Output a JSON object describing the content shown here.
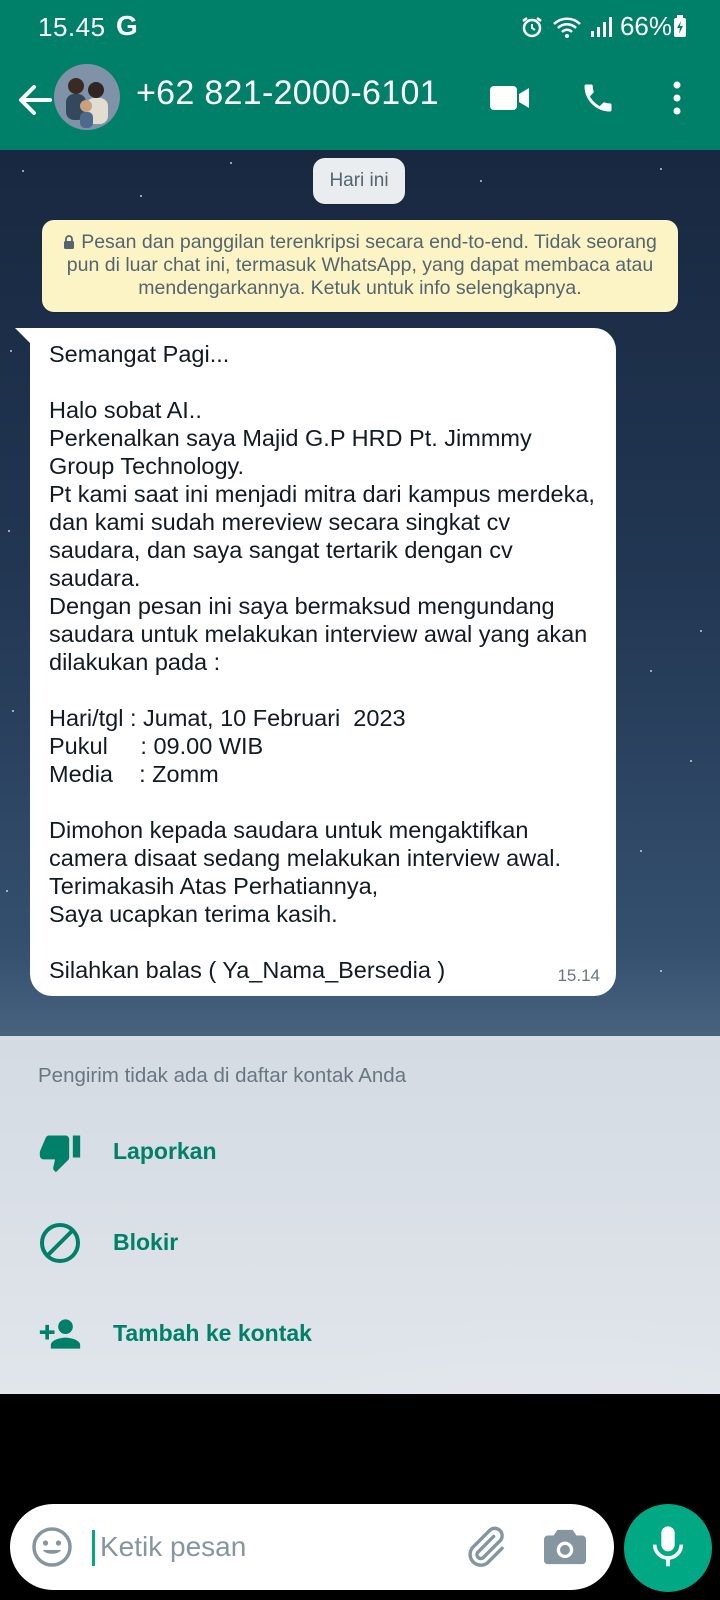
{
  "status_bar": {
    "time": "15.45",
    "network_glyph": "G",
    "battery": "66%",
    "icons": [
      "alarm-icon",
      "wifi-icon",
      "signal-icon",
      "battery-icon"
    ]
  },
  "header": {
    "contact_name": "+62 821-2000-6101",
    "icons": [
      "back-arrow-icon",
      "video-call-icon",
      "voice-call-icon",
      "more-vert-icon"
    ]
  },
  "chat": {
    "date_chip": "Hari ini",
    "encryption_notice": "Pesan dan panggilan terenkripsi secara end-to-end. Tidak seorang pun di luar chat ini, termasuk WhatsApp, yang dapat membaca atau mendengarkannya. Ketuk untuk info selengkapnya.",
    "message": {
      "text": "Semangat Pagi...\n\nHalo sobat AI..\nPerkenalkan saya Majid G.P HRD Pt. Jimmmy Group Technology.\nPt kami saat ini menjadi mitra dari kampus merdeka, dan kami sudah mereview secara singkat cv saudara, dan saya sangat tertarik dengan cv saudara.\nDengan pesan ini saya bermaksud mengundang saudara untuk melakukan interview awal yang akan dilakukan pada :\n\nHari/tgl : Jumat, 10 Februari  2023\nPukul     : 09.00 WIB\nMedia    : Zomm\n\nDimohon kepada saudara untuk mengaktifkan camera disaat sedang melakukan interview awal.\nTerimakasih Atas Perhatiannya,\nSaya ucapkan terima kasih.\n\nSilahkan balas ( Ya_Nama_Bersedia )",
      "time": "15.14"
    }
  },
  "unknown_sender": {
    "title": "Pengirim tidak ada di daftar kontak Anda",
    "actions": [
      {
        "label": "Laporkan",
        "icon": "thumbs-down-icon"
      },
      {
        "label": "Blokir",
        "icon": "block-icon"
      },
      {
        "label": "Tambah ke kontak",
        "icon": "add-contact-icon"
      }
    ]
  },
  "composer": {
    "placeholder": "Ketik pesan",
    "icons": [
      "emoji-icon",
      "attach-icon",
      "camera-icon",
      "mic-icon"
    ]
  },
  "colors": {
    "header_green": "#008069",
    "accent_green": "#00a884",
    "notice_yellow": "#fdf4c5"
  }
}
